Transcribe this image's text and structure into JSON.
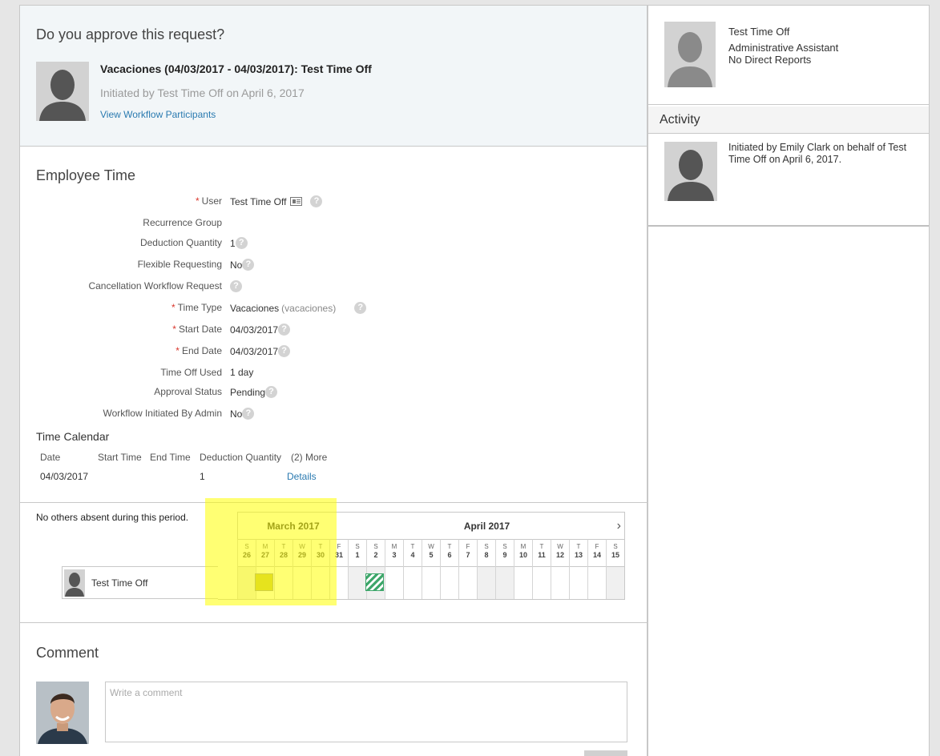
{
  "request": {
    "question": "Do you approve this request?",
    "title": "Vacaciones (04/03/2017 - 04/03/2017): Test Time Off",
    "initiated": "Initiated by Test Time Off on April 6, 2017",
    "view_participants": "View Workflow Participants"
  },
  "employee_time": {
    "title": "Employee Time",
    "fields": [
      {
        "label": "User",
        "value": "Test Time Off",
        "required": true
      },
      {
        "label": "Recurrence Group",
        "value": ""
      },
      {
        "label": "Deduction Quantity",
        "value": "1"
      },
      {
        "label": "Flexible Requesting",
        "value": "No"
      },
      {
        "label": "Cancellation Workflow Request",
        "value": ""
      },
      {
        "label": "Time Type",
        "value": "Vacaciones",
        "extra": "(vacaciones)",
        "required": true
      },
      {
        "label": "Start Date",
        "value": "04/03/2017",
        "required": true
      },
      {
        "label": "End Date",
        "value": "04/03/2017",
        "required": true
      },
      {
        "label": "Time Off Used",
        "value": "1 day"
      },
      {
        "label": "Approval Status",
        "value": "Pending"
      },
      {
        "label": "Workflow Initiated By Admin",
        "value": "No"
      }
    ],
    "required_marker": "*",
    "help_glyph": "?"
  },
  "time_calendar": {
    "title": "Time Calendar",
    "headers": [
      "Date",
      "Start Time",
      "End Time",
      "Deduction Quantity",
      "(2) More"
    ],
    "row": {
      "date": "04/03/2017",
      "start": "",
      "end": "",
      "quantity": "1",
      "details": "Details"
    }
  },
  "absence": {
    "no_others": "No others absent during this period.",
    "months": [
      "March 2017",
      "April 2017"
    ],
    "next_arrow": "›",
    "days": [
      {
        "l": "S",
        "n": "26"
      },
      {
        "l": "M",
        "n": "27"
      },
      {
        "l": "T",
        "n": "28"
      },
      {
        "l": "W",
        "n": "29"
      },
      {
        "l": "T",
        "n": "30"
      },
      {
        "l": "F",
        "n": "31"
      },
      {
        "l": "S",
        "n": "1"
      },
      {
        "l": "S",
        "n": "2"
      },
      {
        "l": "M",
        "n": "3"
      },
      {
        "l": "T",
        "n": "4"
      },
      {
        "l": "W",
        "n": "5"
      },
      {
        "l": "T",
        "n": "6"
      },
      {
        "l": "F",
        "n": "7"
      },
      {
        "l": "S",
        "n": "8"
      },
      {
        "l": "S",
        "n": "9"
      },
      {
        "l": "M",
        "n": "10"
      },
      {
        "l": "T",
        "n": "11"
      },
      {
        "l": "W",
        "n": "12"
      },
      {
        "l": "T",
        "n": "13"
      },
      {
        "l": "F",
        "n": "14"
      },
      {
        "l": "S",
        "n": "15"
      }
    ],
    "user_name": "Test Time Off"
  },
  "comment": {
    "title": "Comment",
    "placeholder": "Write a comment"
  },
  "profile": {
    "name": "Test Time Off",
    "job_title": "Administrative Assistant",
    "reports": "No Direct Reports"
  },
  "activity": {
    "title": "Activity",
    "text": "Initiated by Emily Clark on behalf of Test Time Off on April 6, 2017."
  },
  "colors": {
    "link": "#2a7ab0",
    "required": "#d9362c",
    "highlight": "#ffff00",
    "absence_stripe": "#3da66a"
  }
}
